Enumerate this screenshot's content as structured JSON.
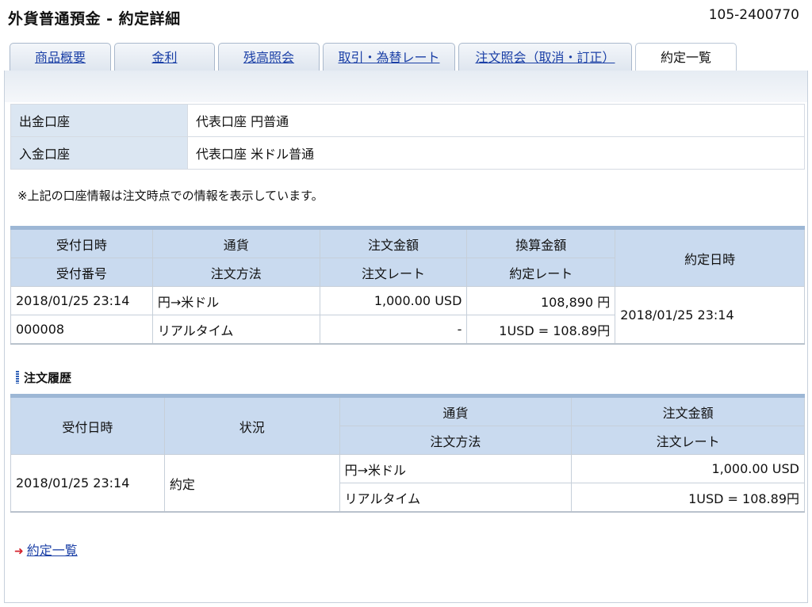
{
  "header": {
    "title": "外貨普通預金 - 約定詳細",
    "account_number": "105-2400770"
  },
  "tabs": [
    {
      "label": "商品概要",
      "active": false
    },
    {
      "label": "金利",
      "active": false
    },
    {
      "label": "残高照会",
      "active": false
    },
    {
      "label": "取引・為替レート",
      "active": false
    },
    {
      "label": "注文照会（取消・訂正）",
      "active": false
    },
    {
      "label": "約定一覧",
      "active": true
    }
  ],
  "accounts": {
    "withdraw_label": "出金口座",
    "withdraw_value": "代表口座 円普通",
    "deposit_label": "入金口座",
    "deposit_value": "代表口座 米ドル普通"
  },
  "note": "※上記の口座情報は注文時点での情報を表示しています。",
  "trade": {
    "headers": {
      "received_datetime": "受付日時",
      "currency": "通貨",
      "order_amount": "注文金額",
      "converted_amount": "換算金額",
      "execution_datetime": "約定日時",
      "receipt_number": "受付番号",
      "order_method": "注文方法",
      "order_rate": "注文レート",
      "execution_rate": "約定レート"
    },
    "values": {
      "received_datetime": "2018/01/25 23:14",
      "currency": "円→米ドル",
      "order_amount": "1,000.00 USD",
      "converted_amount": "108,890 円",
      "execution_datetime": "2018/01/25 23:14",
      "receipt_number": "000008",
      "order_method": "リアルタイム",
      "order_rate": "-",
      "execution_rate": "1USD = 108.89円"
    }
  },
  "history": {
    "title": "注文履歴",
    "headers": {
      "received_datetime": "受付日時",
      "status": "状況",
      "currency": "通貨",
      "order_amount": "注文金額",
      "order_method": "注文方法",
      "order_rate": "注文レート"
    },
    "row": {
      "received_datetime": "2018/01/25 23:14",
      "status": "約定",
      "currency": "円→米ドル",
      "order_amount": "1,000.00 USD",
      "order_method": "リアルタイム",
      "order_rate": "1USD = 108.89円"
    }
  },
  "footer": {
    "back_link": "約定一覧",
    "arrow_icon": "arrow-right-icon",
    "arrow_color": "#d4232c"
  },
  "colors": {
    "link": "#1a3fa6",
    "header_cell": "#c9daef",
    "label_cell": "#dbe6f2",
    "table_top_border": "#9db7d5"
  }
}
